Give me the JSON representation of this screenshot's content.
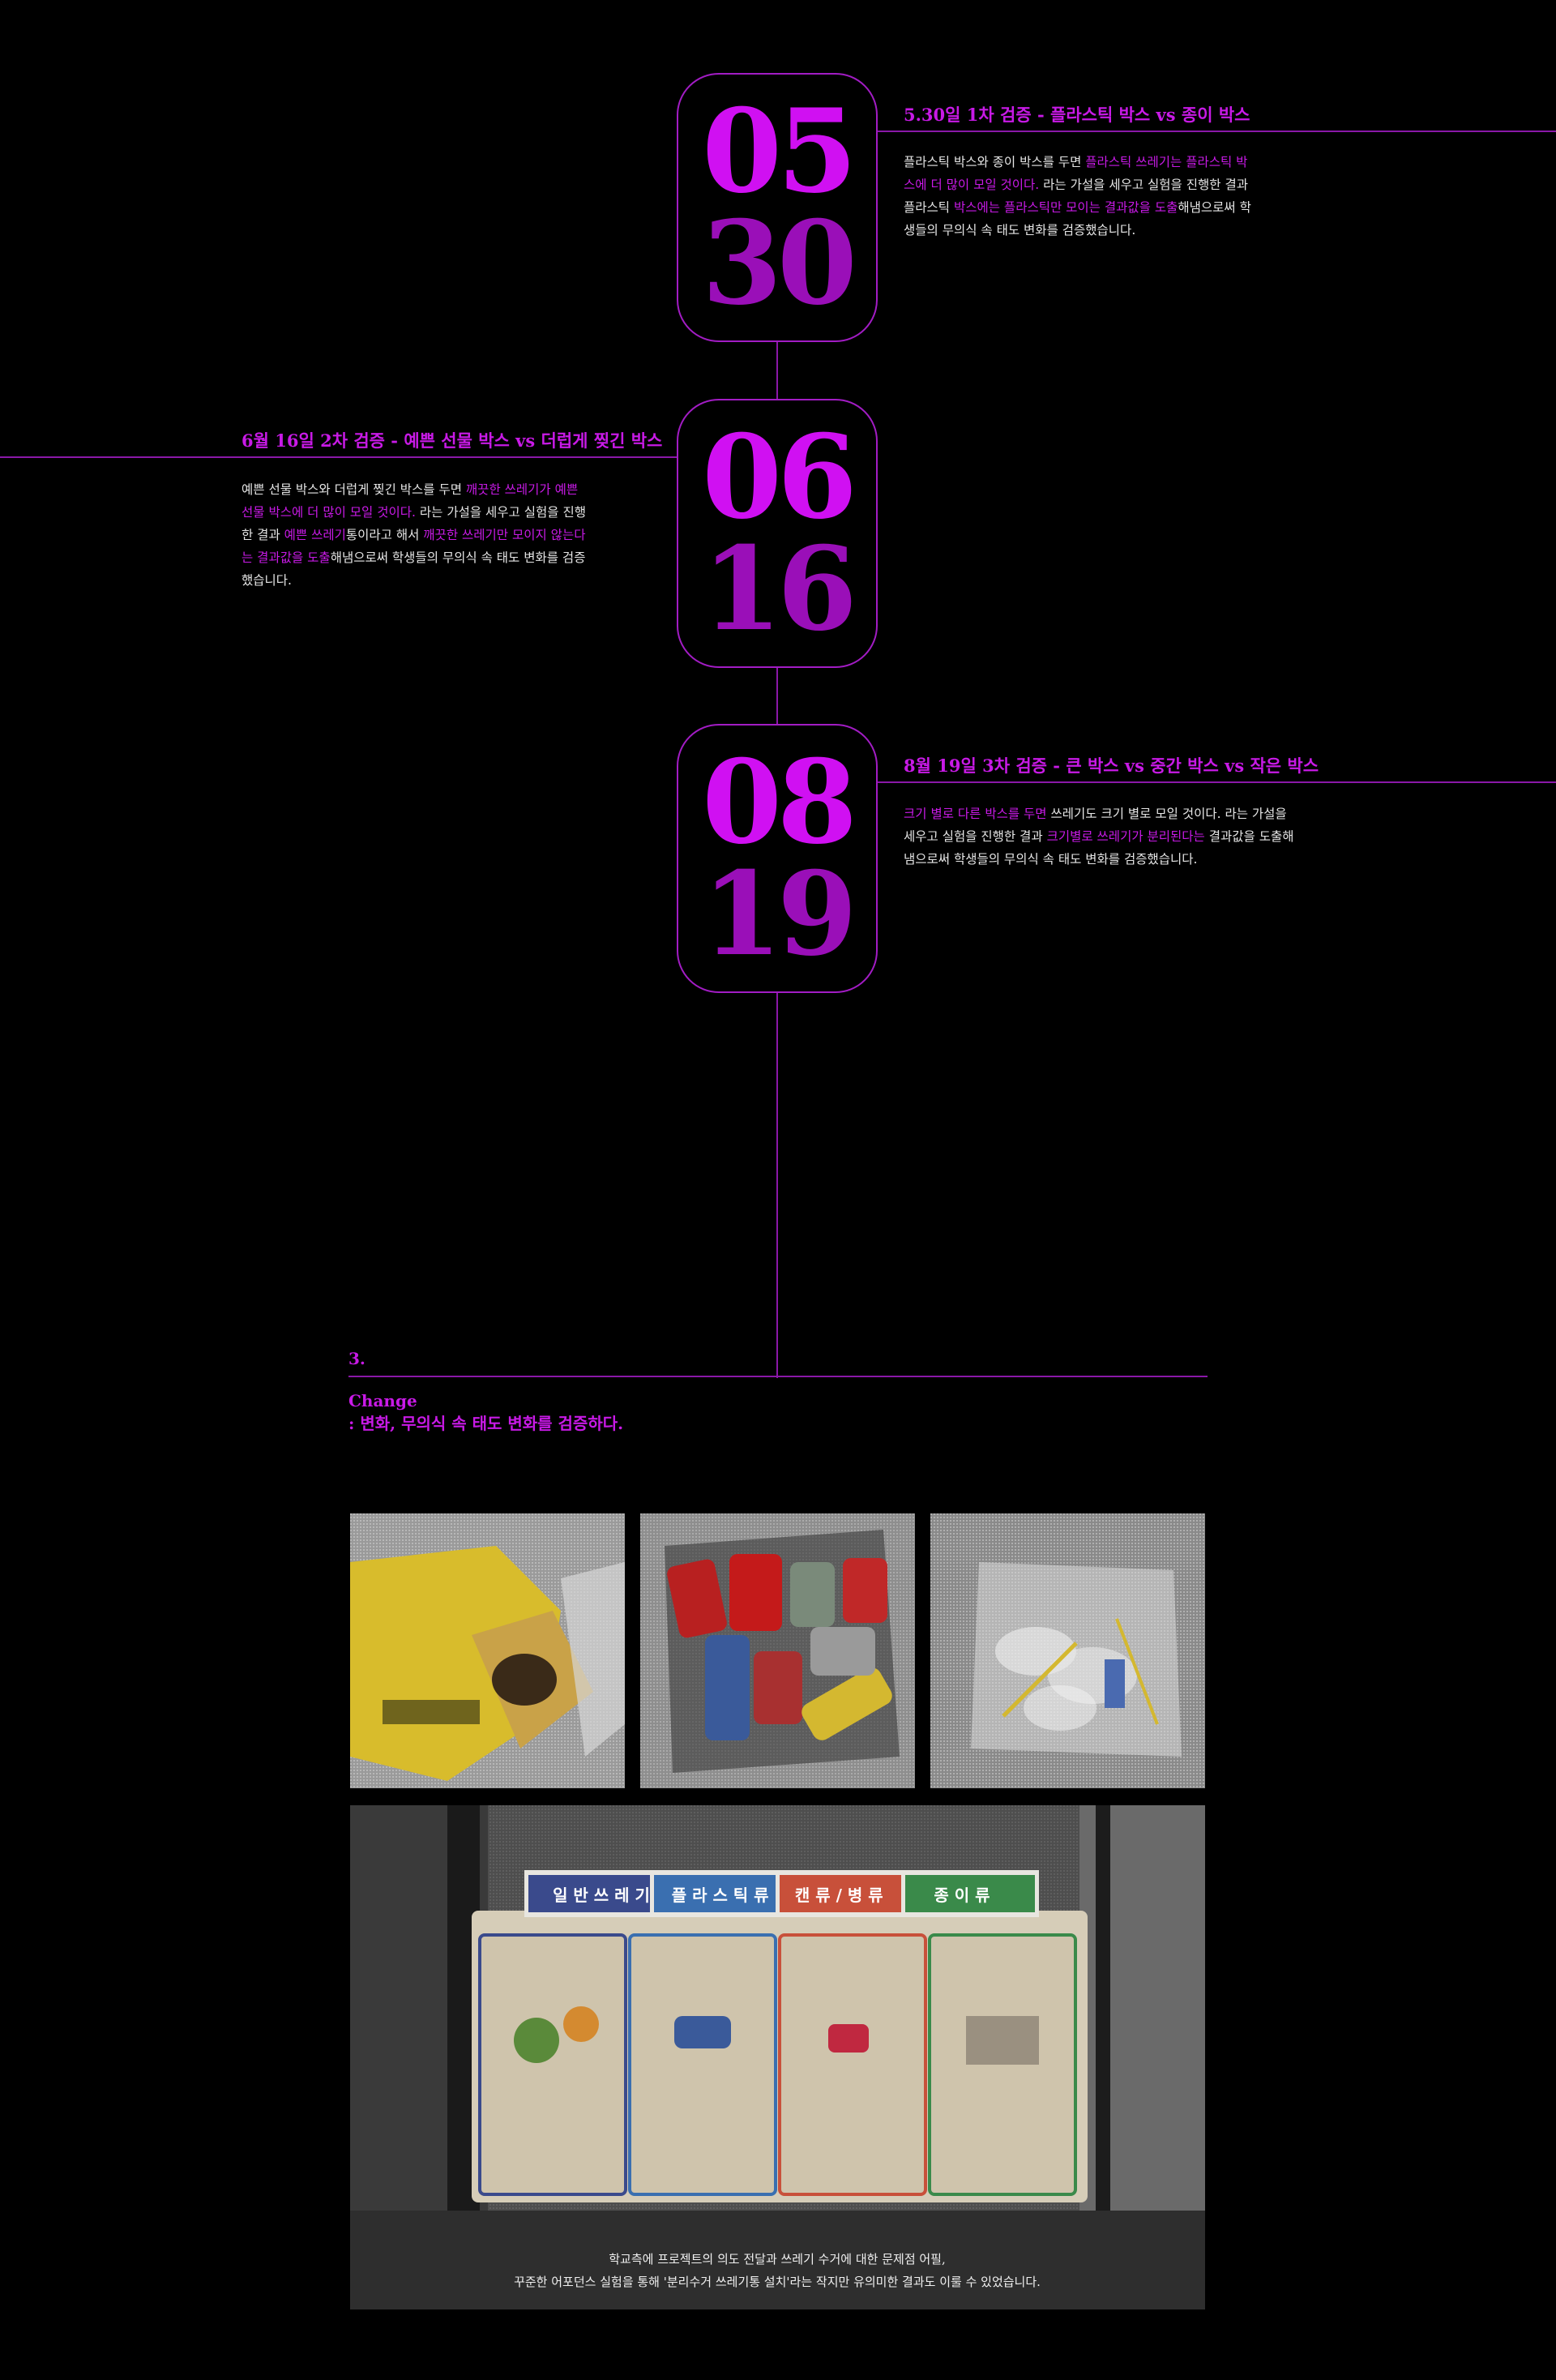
{
  "timeline": [
    {
      "date_top": "05",
      "date_bottom": "30",
      "title": "5.30일 1차 검증 - 플라스틱 박스 vs 종이 박스",
      "body": [
        {
          "t": "플라스틱 박스와 종이 박스를 두면 ",
          "h": false
        },
        {
          "t": "플라스틱 쓰레기는 플라스틱 박스에 더 많이 모일 것이다.",
          "h": true
        },
        {
          "t": " 라는 가설을 세우고 실험을 진행한 결과 플라스틱 ",
          "h": false
        },
        {
          "t": "박스에는 플라스틱만 모이는 결과값을 도출",
          "h": true
        },
        {
          "t": "해냄으로써 학생들의 무의식 속 태도 변화를 검증했습니다.",
          "h": false
        }
      ]
    },
    {
      "date_top": "06",
      "date_bottom": "16",
      "title": "6월 16일 2차 검증 - 예쁜 선물 박스 vs 더럽게 찢긴 박스",
      "body": [
        {
          "t": "예쁜 선물 박스와 더럽게 찢긴 박스를 두면 ",
          "h": false
        },
        {
          "t": "깨끗한 쓰레기가 예쁜 선물 박스에 더 많이 모일 것이다.",
          "h": true
        },
        {
          "t": " 라는 가설을 세우고 실험을 진행한 결과 ",
          "h": false
        },
        {
          "t": "예쁜 쓰레기",
          "h": true
        },
        {
          "t": "통이라고 해서 ",
          "h": false
        },
        {
          "t": "깨끗한 쓰레기만 모이지 않는다는 결과값을 도출",
          "h": true
        },
        {
          "t": "해냄으로써 학생들의 무의식 속 태도 변화를 검증했습니다.",
          "h": false
        }
      ]
    },
    {
      "date_top": "08",
      "date_bottom": "19",
      "title": "8월 19일 3차 검증 - 큰 박스 vs 중간 박스 vs 작은 박스",
      "body": [
        {
          "t": "크기 별로 다른 박스를 두면",
          "h": true
        },
        {
          "t": " 쓰레기도 크기 별로 모일 것이다. 라는 가설을 세우고 실험을 진행한 결과 ",
          "h": false
        },
        {
          "t": "크기별로 쓰레기가 분리된다는",
          "h": true
        },
        {
          "t": " 결과값을 도출해냄으로써 학생들의 무의식 속 태도 변화를 검증했습니다.",
          "h": false
        }
      ]
    }
  ],
  "section": {
    "number": "3.",
    "title_line1": "Change",
    "title_line2": ": 변화, 무의식 속 태도 변화를 검증하다."
  },
  "bins": {
    "labels": [
      "일 반 쓰 레 기",
      "플 라 스 틱 류",
      "캔 류 / 병 류",
      "종    이    류"
    ],
    "colors": [
      "#3a4a8c",
      "#3a6fb0",
      "#c8503a",
      "#3a8a4a"
    ]
  },
  "caption": {
    "line1": "학교측에 프로젝트의 의도 전달과 쓰레기 수거에 대한 문제점 어필,",
    "line2": "꾸준한 어포던스 실험을 통해 '분리수거 쓰레기통 설치'라는 작지만 유의미한 결과도 이룰 수 있었습니다."
  },
  "colors": {
    "accent": "#c81ae6",
    "accent_dark": "#9a0fb8",
    "line": "#8a18a8",
    "background": "#000000"
  }
}
